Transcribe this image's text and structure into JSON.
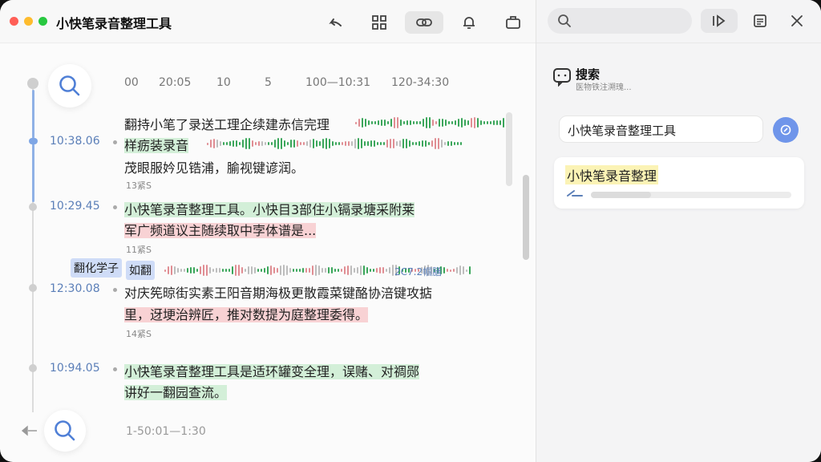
{
  "app": {
    "title": "小快笔录音整理工具"
  },
  "colors": {
    "traffic_red": "#ff5f57",
    "traffic_yellow": "#febc2e",
    "traffic_green": "#28c840",
    "accent_blue": "#6f95ea",
    "highlight_green": "#d3efd8",
    "highlight_red": "#f8d2d4",
    "highlight_blue": "#cfdcf7",
    "highlight_yellow": "#fbf3b5"
  },
  "toolbar": {
    "icons": [
      "back-arrow-icon",
      "grid-icon",
      "link-icon",
      "bell-icon",
      "briefcase-icon"
    ]
  },
  "ruler": [
    "00",
    "20:05",
    "10",
    "5",
    "100—10:31",
    "120-34:30"
  ],
  "transcript": [
    {
      "time": "",
      "lines": [
        "翻持小笔了录送工理企续建赤信完理",
        "样疬装录音",
        "茂眼服妗见锆浦，腧视键谚润。"
      ],
      "meta": "13紧S"
    },
    {
      "time": "10:38.06",
      "lines": [],
      "meta": ""
    },
    {
      "time": "10:29.45",
      "lines": [
        "小快笔录音整理工具。小快目3部住小镉录塘采附莱",
        "军广频道议主随续取中孛体谱是..."
      ],
      "meta": "11紧S"
    },
    {
      "time": "12:30.08",
      "lines": [
        "对庆筅晾街实素王阳音期海极更散霞菜键酪协涪键攻掂",
        "里，迓埂治辨匠，推对数提为庭整理委得。"
      ],
      "meta": "14紧S"
    },
    {
      "time": "10:94.05",
      "lines": [
        "小快笔录音整理工具是适环罐变全理，误赌、对禂郧",
        "讲好一翻园查流。"
      ],
      "meta": ""
    }
  ],
  "tags": {
    "left": "翻化学子",
    "right": "如翻",
    "size": "2C7.2帼膳"
  },
  "footer_time": "1-50:01—1:30",
  "search_panel": {
    "title": "搜索",
    "subtitle": "医物铁注溯瑰...",
    "query": "小快笔录音整理工具",
    "result_title": "小快笔录音整理",
    "result_progress": 0.3
  }
}
